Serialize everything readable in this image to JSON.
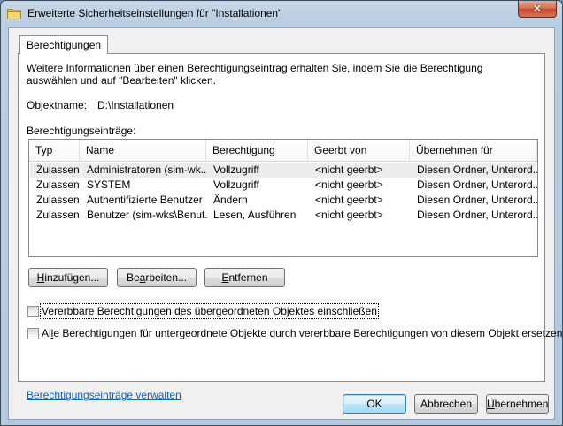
{
  "window": {
    "title": "Erweiterte Sicherheitseinstellungen für \"Installationen\"",
    "close_glyph": "✕"
  },
  "tabs": [
    {
      "label": "Berechtigungen",
      "selected": true
    }
  ],
  "info_text": "Weitere Informationen über einen Berechtigungseintrag erhalten Sie, indem Sie die Berechtigung auswählen und auf \"Bearbeiten\" klicken.",
  "object": {
    "label": "Objektname:",
    "value": "D:\\Installationen"
  },
  "entries_label": "Berechtigungseinträge:",
  "table": {
    "columns": [
      "Typ",
      "Name",
      "Berechtigung",
      "Geerbt von",
      "Übernehmen für"
    ],
    "rows": [
      [
        "Zulassen",
        "Administratoren (sim-wk...",
        "Vollzugriff",
        "<nicht geerbt>",
        "Diesen Ordner, Unterord..."
      ],
      [
        "Zulassen",
        "SYSTEM",
        "Vollzugriff",
        "<nicht geerbt>",
        "Diesen Ordner, Unterord..."
      ],
      [
        "Zulassen",
        "Authentifizierte Benutzer",
        "Ändern",
        "<nicht geerbt>",
        "Diesen Ordner, Unterord..."
      ],
      [
        "Zulassen",
        "Benutzer (sim-wks\\Benut...",
        "Lesen, Ausführen",
        "<nicht geerbt>",
        "Diesen Ordner, Unterord..."
      ]
    ],
    "selected_row": 0
  },
  "buttons": {
    "add": {
      "pre": "",
      "key": "H",
      "post": "inzufügen..."
    },
    "edit": {
      "pre": "Be",
      "key": "a",
      "post": "rbeiten..."
    },
    "remove": {
      "pre": "",
      "key": "E",
      "post": "ntfernen"
    }
  },
  "checkboxes": {
    "inherit": {
      "pre": "",
      "key": "V",
      "post": "ererbbare Berechtigungen des übergeordneten Objektes einschließen",
      "checked": false
    },
    "replace": {
      "pre": "Al",
      "key": "l",
      "post": "e Berechtigungen für untergeordnete Objekte durch vererbbare Berechtigungen von diesem Objekt ersetzen",
      "checked": false
    }
  },
  "manage_link": "Berechtigungseinträge verwalten",
  "footer": {
    "ok": "OK",
    "cancel": "Abbrechen",
    "apply": {
      "pre": "",
      "key": "Ü",
      "post": "bernehmen"
    }
  },
  "colors": {
    "selection": "#ececec",
    "link": "#0066cc",
    "title_bar": "#b9cde2"
  },
  "icons": {
    "title": "folder-icon",
    "close": "close-icon"
  }
}
